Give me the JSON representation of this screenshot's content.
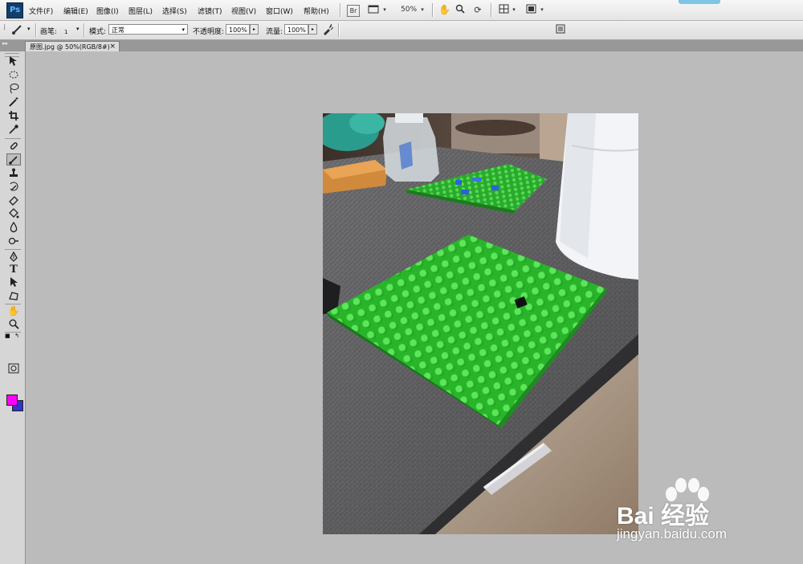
{
  "app": {
    "logo": "Ps"
  },
  "menu": [
    "文件(F)",
    "编辑(E)",
    "图像(I)",
    "图层(L)",
    "选择(S)",
    "滤镜(T)",
    "视图(V)",
    "窗口(W)",
    "帮助(H)"
  ],
  "menubar": {
    "zoom": "50%",
    "bridge_label": "Br"
  },
  "options": {
    "brush_label": "画笔:",
    "brush_size": "1",
    "mode_label": "模式:",
    "mode_value": "正常",
    "opacity_label": "不透明度:",
    "opacity_value": "100%",
    "flow_label": "流量:",
    "flow_value": "100%"
  },
  "document": {
    "tab_title": "原图.jpg @ 50%(RGB/8#)",
    "close": "×"
  },
  "colors": {
    "foreground": "#ff00ff",
    "background": "#3333cc",
    "accent": "#1a8a1a"
  },
  "tools": [
    "move-icon",
    "marquee-icon",
    "lasso-icon",
    "magic-wand-icon",
    "crop-icon",
    "eyedropper-icon",
    "healing-brush-icon",
    "brush-icon",
    "clone-stamp-icon",
    "history-brush-icon",
    "eraser-icon",
    "paint-bucket-icon",
    "blur-icon",
    "dodge-icon",
    "pen-icon",
    "type-icon",
    "path-selection-icon",
    "shape-icon",
    "hand-icon",
    "zoom-icon"
  ],
  "tool_glyphs": {
    "type": "T"
  },
  "watermark": {
    "brand": "Bai 经验",
    "url": "jingyan.baidu.com"
  }
}
